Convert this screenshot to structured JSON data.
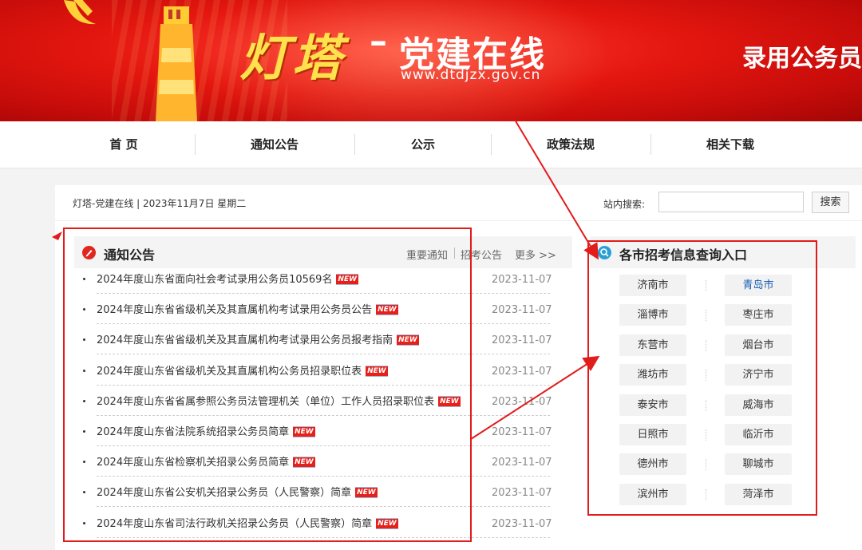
{
  "banner": {
    "brand_cn": "灯塔",
    "dash": "–",
    "brand_sub": "党建在线",
    "domain": "www.dtdjzx.gov.cn",
    "right_title": "录用公务员"
  },
  "nav": {
    "items": [
      {
        "label": "首 页"
      },
      {
        "label": "通知公告"
      },
      {
        "label": "公示"
      },
      {
        "label": "政策法规"
      },
      {
        "label": "相关下载"
      }
    ]
  },
  "infobar": {
    "site_date": "灯塔-党建在线 | 2023年11月7日 星期二",
    "search_label": "站内搜索:",
    "search_value": "",
    "search_button": "搜索"
  },
  "notices": {
    "title": "通知公告",
    "tabs": [
      "重要通知",
      "招考公告",
      "更多 >>"
    ],
    "new_badge": "NEW",
    "items": [
      {
        "title": "2024年度山东省面向社会考试录用公务员10569名",
        "date": "2023-11-07",
        "is_new": true
      },
      {
        "title": "2024年度山东省省级机关及其直属机构考试录用公务员公告",
        "date": "2023-11-07",
        "is_new": true
      },
      {
        "title": "2024年度山东省省级机关及其直属机构考试录用公务员报考指南",
        "date": "2023-11-07",
        "is_new": true
      },
      {
        "title": "2024年度山东省省级机关及其直属机构公务员招录职位表",
        "date": "2023-11-07",
        "is_new": true
      },
      {
        "title": "2024年度山东省省属参照公务员法管理机关（单位）工作人员招录职位表",
        "date": "2023-11-07",
        "is_new": true
      },
      {
        "title": "2024年度山东省法院系统招录公务员简章",
        "date": "2023-11-07",
        "is_new": true
      },
      {
        "title": "2024年度山东省检察机关招录公务员简章",
        "date": "2023-11-07",
        "is_new": true
      },
      {
        "title": "2024年度山东省公安机关招录公务员（人民警察）简章",
        "date": "2023-11-07",
        "is_new": true
      },
      {
        "title": "2024年度山东省司法行政机关招录公务员（人民警察）简章",
        "date": "2023-11-07",
        "is_new": true
      }
    ]
  },
  "cities": {
    "title": "各市招考信息查询入口",
    "active": "青岛市",
    "list": [
      "济南市",
      "青岛市",
      "淄博市",
      "枣庄市",
      "东营市",
      "烟台市",
      "潍坊市",
      "济宁市",
      "泰安市",
      "威海市",
      "日照市",
      "临沂市",
      "德州市",
      "聊城市",
      "滨州市",
      "菏泽市"
    ]
  },
  "colors": {
    "banner_red": "#e3160f",
    "brand_yellow": "#ffe14d",
    "annotation_red": "#e21b1b",
    "link_blue": "#1a5fb4"
  }
}
